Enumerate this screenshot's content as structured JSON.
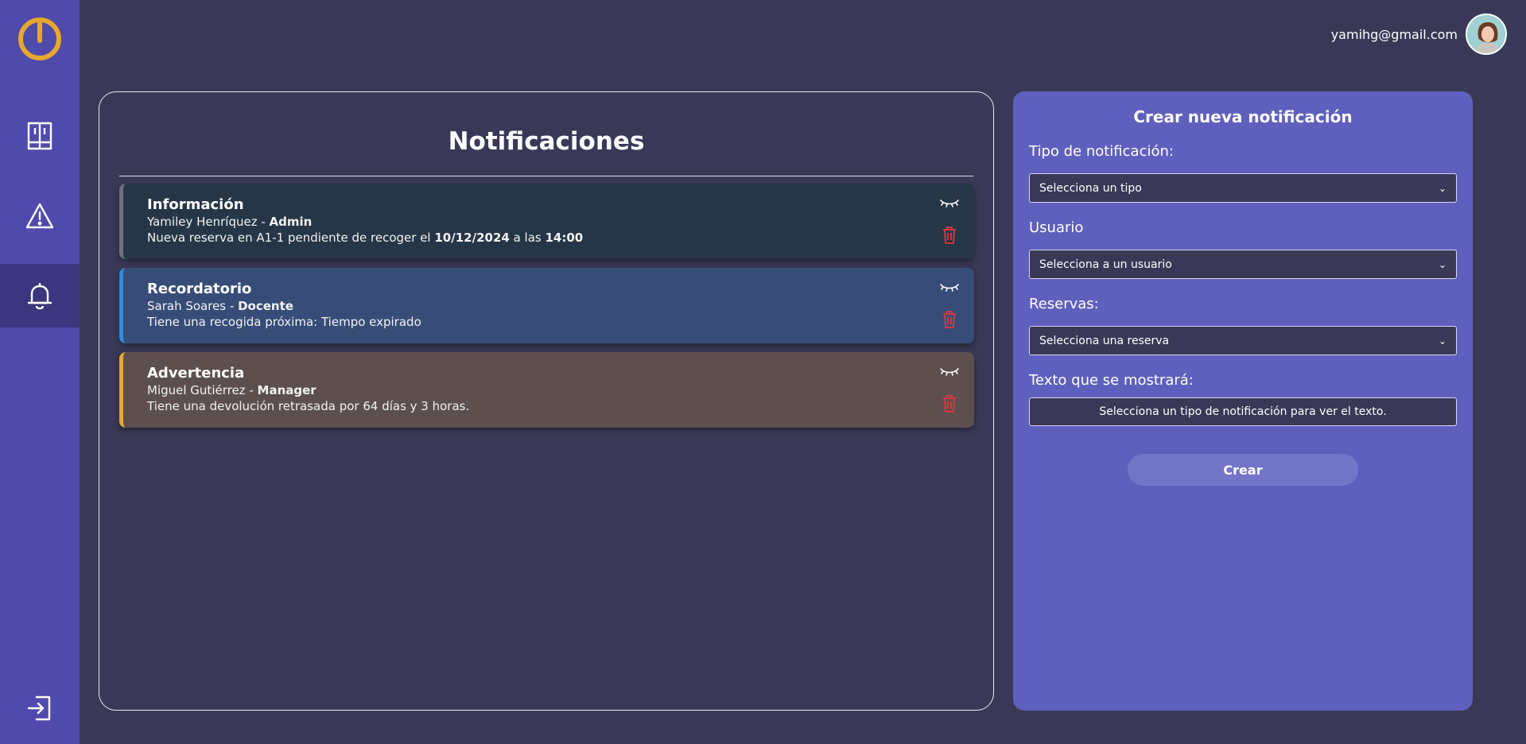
{
  "colors": {
    "background": "#393957",
    "sidebar": "#4f4aab",
    "sidebar_active": "#3a377f",
    "logo": "#e9a82c",
    "create_panel": "#5f60bd",
    "info_card": "#263647",
    "reminder_card": "#374d78",
    "warning_card": "#5e4f4f",
    "info_border": "#6f6f7f",
    "reminder_border": "#2f8ce0",
    "warning_border": "#e8a92d",
    "delete_red": "#e0373f"
  },
  "sidebar": {
    "items": [
      {
        "icon": "locker-icon",
        "active": false
      },
      {
        "icon": "warning-icon",
        "active": false
      },
      {
        "icon": "bell-icon",
        "active": true
      }
    ],
    "logout_icon": "logout-icon"
  },
  "header": {
    "email": "yamihg@gmail.com"
  },
  "notifications": {
    "title": "Notificaciones",
    "items": [
      {
        "type": "Información",
        "user": "Yamiley Henríquez",
        "separator": " - ",
        "role": "Admin",
        "msg_pre": "Nueva reserva en A1-1 pendiente de recoger el ",
        "date": "10/12/2024",
        "msg_mid": " a las ",
        "time": "14:00"
      },
      {
        "type": "Recordatorio",
        "user": "Sarah Soares",
        "separator": " - ",
        "role": "Docente",
        "msg": "Tiene una recogida próxima: Tiempo expirado"
      },
      {
        "type": "Advertencia",
        "user": "Miguel Gutiérrez",
        "separator": " - ",
        "role": "Manager",
        "msg": "Tiene una devolución retrasada por 64 días y 3 horas."
      }
    ]
  },
  "create": {
    "title": "Crear nueva notificación",
    "type_label": "Tipo de notificación:",
    "type_value": "Selecciona un tipo",
    "user_label": "Usuario",
    "user_value": "Selecciona a un usuario",
    "reservation_label": "Reservas:",
    "reservation_value": "Selecciona una reserva",
    "text_label": "Texto que se mostrará:",
    "text_preview": "Selecciona un tipo de notificación para ver el texto.",
    "button": "Crear"
  }
}
